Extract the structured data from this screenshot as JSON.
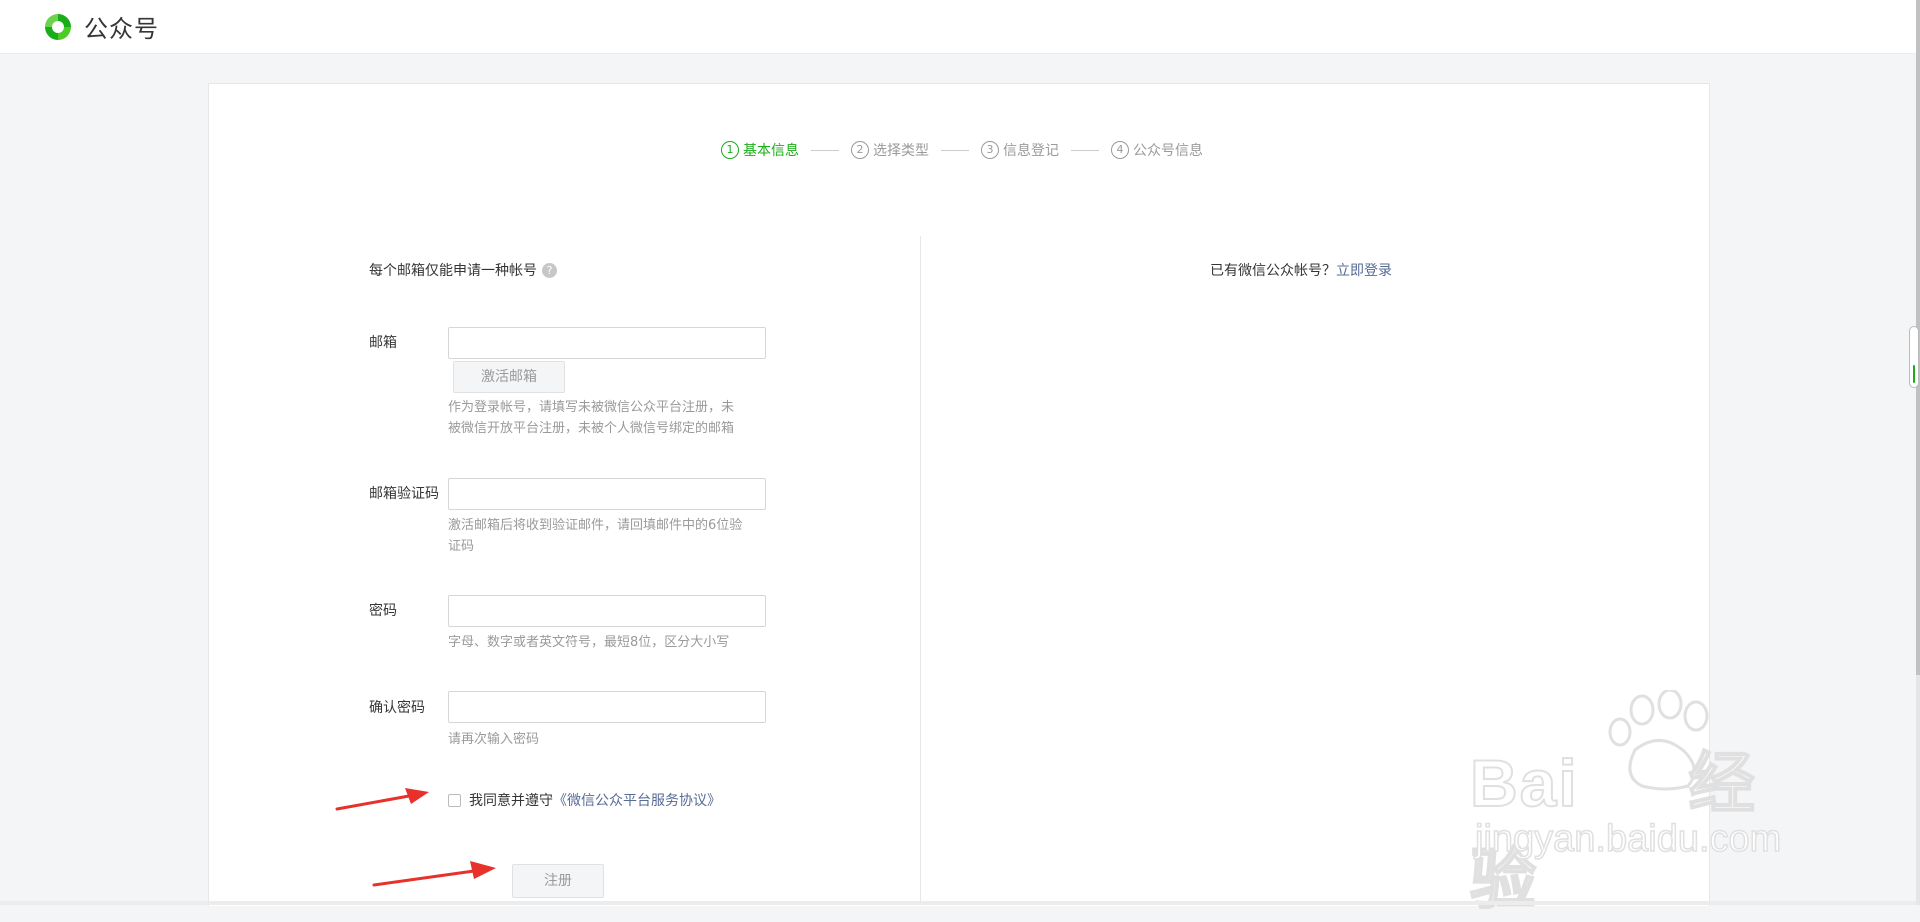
{
  "header": {
    "logo_text": "公众号",
    "logo_icon": "wechat-official-account-logo"
  },
  "steps": [
    {
      "num": "1",
      "label": "基本信息",
      "active": true
    },
    {
      "num": "2",
      "label": "选择类型",
      "active": false
    },
    {
      "num": "3",
      "label": "信息登记",
      "active": false
    },
    {
      "num": "4",
      "label": "公众号信息",
      "active": false
    }
  ],
  "form": {
    "note": "每个邮箱仅能申请一种帐号",
    "help_icon": "question-icon",
    "email": {
      "label": "邮箱",
      "value": "",
      "activate_button": "激活邮箱",
      "hint_line1": "作为登录帐号，请填写未被微信公众平台注册，未",
      "hint_line2": "被微信开放平台注册，未被个人微信号绑定的邮箱"
    },
    "code": {
      "label": "邮箱验证码",
      "value": "",
      "hint_line1": "激活邮箱后将收到验证邮件，请回填邮件中的6位验",
      "hint_line2": "证码"
    },
    "password": {
      "label": "密码",
      "value": "",
      "hint": "字母、数字或者英文符号，最短8位，区分大小写"
    },
    "confirm_password": {
      "label": "确认密码",
      "value": "",
      "hint": "请再次输入密码"
    },
    "agree_text": "我同意并遵守",
    "agree_link": "《微信公众平台服务协议》",
    "register_button": "注册"
  },
  "login": {
    "text": "已有微信公众帐号？",
    "link": "立即登录"
  },
  "watermark": {
    "brand": "Bai",
    "brand2": "经验",
    "url": "jingyan.baidu.com"
  },
  "colors": {
    "accent": "#1aad19",
    "link": "#576b95",
    "arrow": "#e8312b"
  }
}
